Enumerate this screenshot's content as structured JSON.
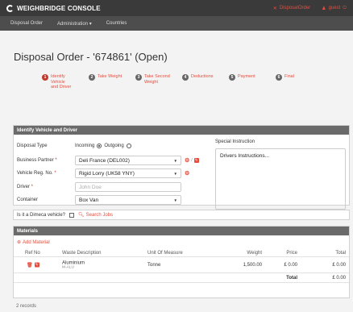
{
  "app": {
    "brand": "WEIGHBRIDGE CONSOLE"
  },
  "topbar": {
    "user_menu_1": "DisposalOrder",
    "user_menu_2": "guest"
  },
  "nav": {
    "items": [
      "Disposal Order",
      "Administration",
      "Countries"
    ]
  },
  "page": {
    "title": "Disposal Order - '674861' (Open)"
  },
  "steps": [
    {
      "num": "1",
      "label": "Identify Vehicle and Driver"
    },
    {
      "num": "2",
      "label": "Take Weight"
    },
    {
      "num": "3",
      "label": "Take Second Weight"
    },
    {
      "num": "4",
      "label": "Deductions"
    },
    {
      "num": "5",
      "label": "Payment"
    },
    {
      "num": "6",
      "label": "Final"
    }
  ],
  "identify": {
    "heading": "Identify Vehicle and Driver",
    "disposal_type_label": "Disposal Type",
    "incoming": "Incoming",
    "outgoing": "Outgoing",
    "partner_label": "Business Partner",
    "partner_value": "Deli France (DEL002)",
    "vehicle_label": "Vehicle Reg. No.",
    "vehicle_value": "Rigid Lorry (UK58 YNY)",
    "driver_label": "Driver",
    "driver_placeholder": "John Doe",
    "container_label": "Container",
    "container_value": "Box Van",
    "special_label": "Special Instruction",
    "special_value": "Drivers Instructions..."
  },
  "dimeca": {
    "question": "Is it a Dimeca vehicle?",
    "search_label": "Search Jobs"
  },
  "materials": {
    "heading": "Materials",
    "add_label": "Add Material",
    "columns": [
      "Ref No",
      "Waste Description",
      "Unit Of Measure",
      "Weight",
      "Price",
      "Total"
    ],
    "rows": [
      {
        "desc": "Aluminium",
        "code": "M-ALU",
        "unit": "Tonne",
        "weight": "1,500.00",
        "price": "£ 0.00",
        "total": "£ 0.00"
      }
    ],
    "total_label": "Total",
    "total_value": "£ 0.00"
  },
  "footer": {
    "records": "2 records"
  },
  "colors": {
    "accent": "#e74c3c",
    "topbar": "#3a3a3a",
    "navbar": "#4d4d4d",
    "panel_head": "#6a6a6a"
  }
}
